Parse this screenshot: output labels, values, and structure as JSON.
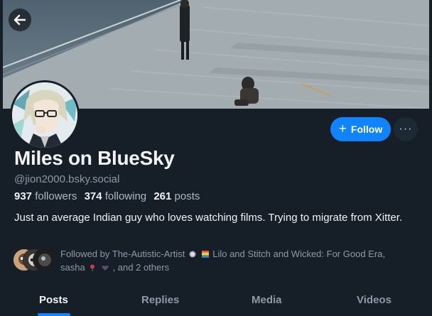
{
  "profile": {
    "display_name": "Miles on BlueSky",
    "handle": "@jion2000.bsky.social",
    "follow_label": "Follow",
    "more_label": "···",
    "stats": {
      "followers_count": "937",
      "followers_label": "followers",
      "following_count": "374",
      "following_label": "following",
      "posts_count": "261",
      "posts_label": "posts"
    },
    "bio": "Just an average Indian guy who loves watching films. Trying to migrate from Xitter.",
    "followed_by": {
      "prefix": "Followed by",
      "user1": "The-Autistic-Artist",
      "user2": "Lilo and Stitch and Wicked: For Good Era,",
      "user3": "sasha",
      "suffix": ", and 2 others"
    }
  },
  "tabs": [
    {
      "label": "Posts"
    },
    {
      "label": "Replies"
    },
    {
      "label": "Media"
    },
    {
      "label": "Videos"
    }
  ],
  "colors": {
    "background": "#161e27",
    "accent": "#1083fe",
    "muted_text": "#8d9aa9"
  },
  "icons": {
    "back": "arrow-left-icon",
    "follow": "plus-icon",
    "more": "ellipsis-icon"
  }
}
